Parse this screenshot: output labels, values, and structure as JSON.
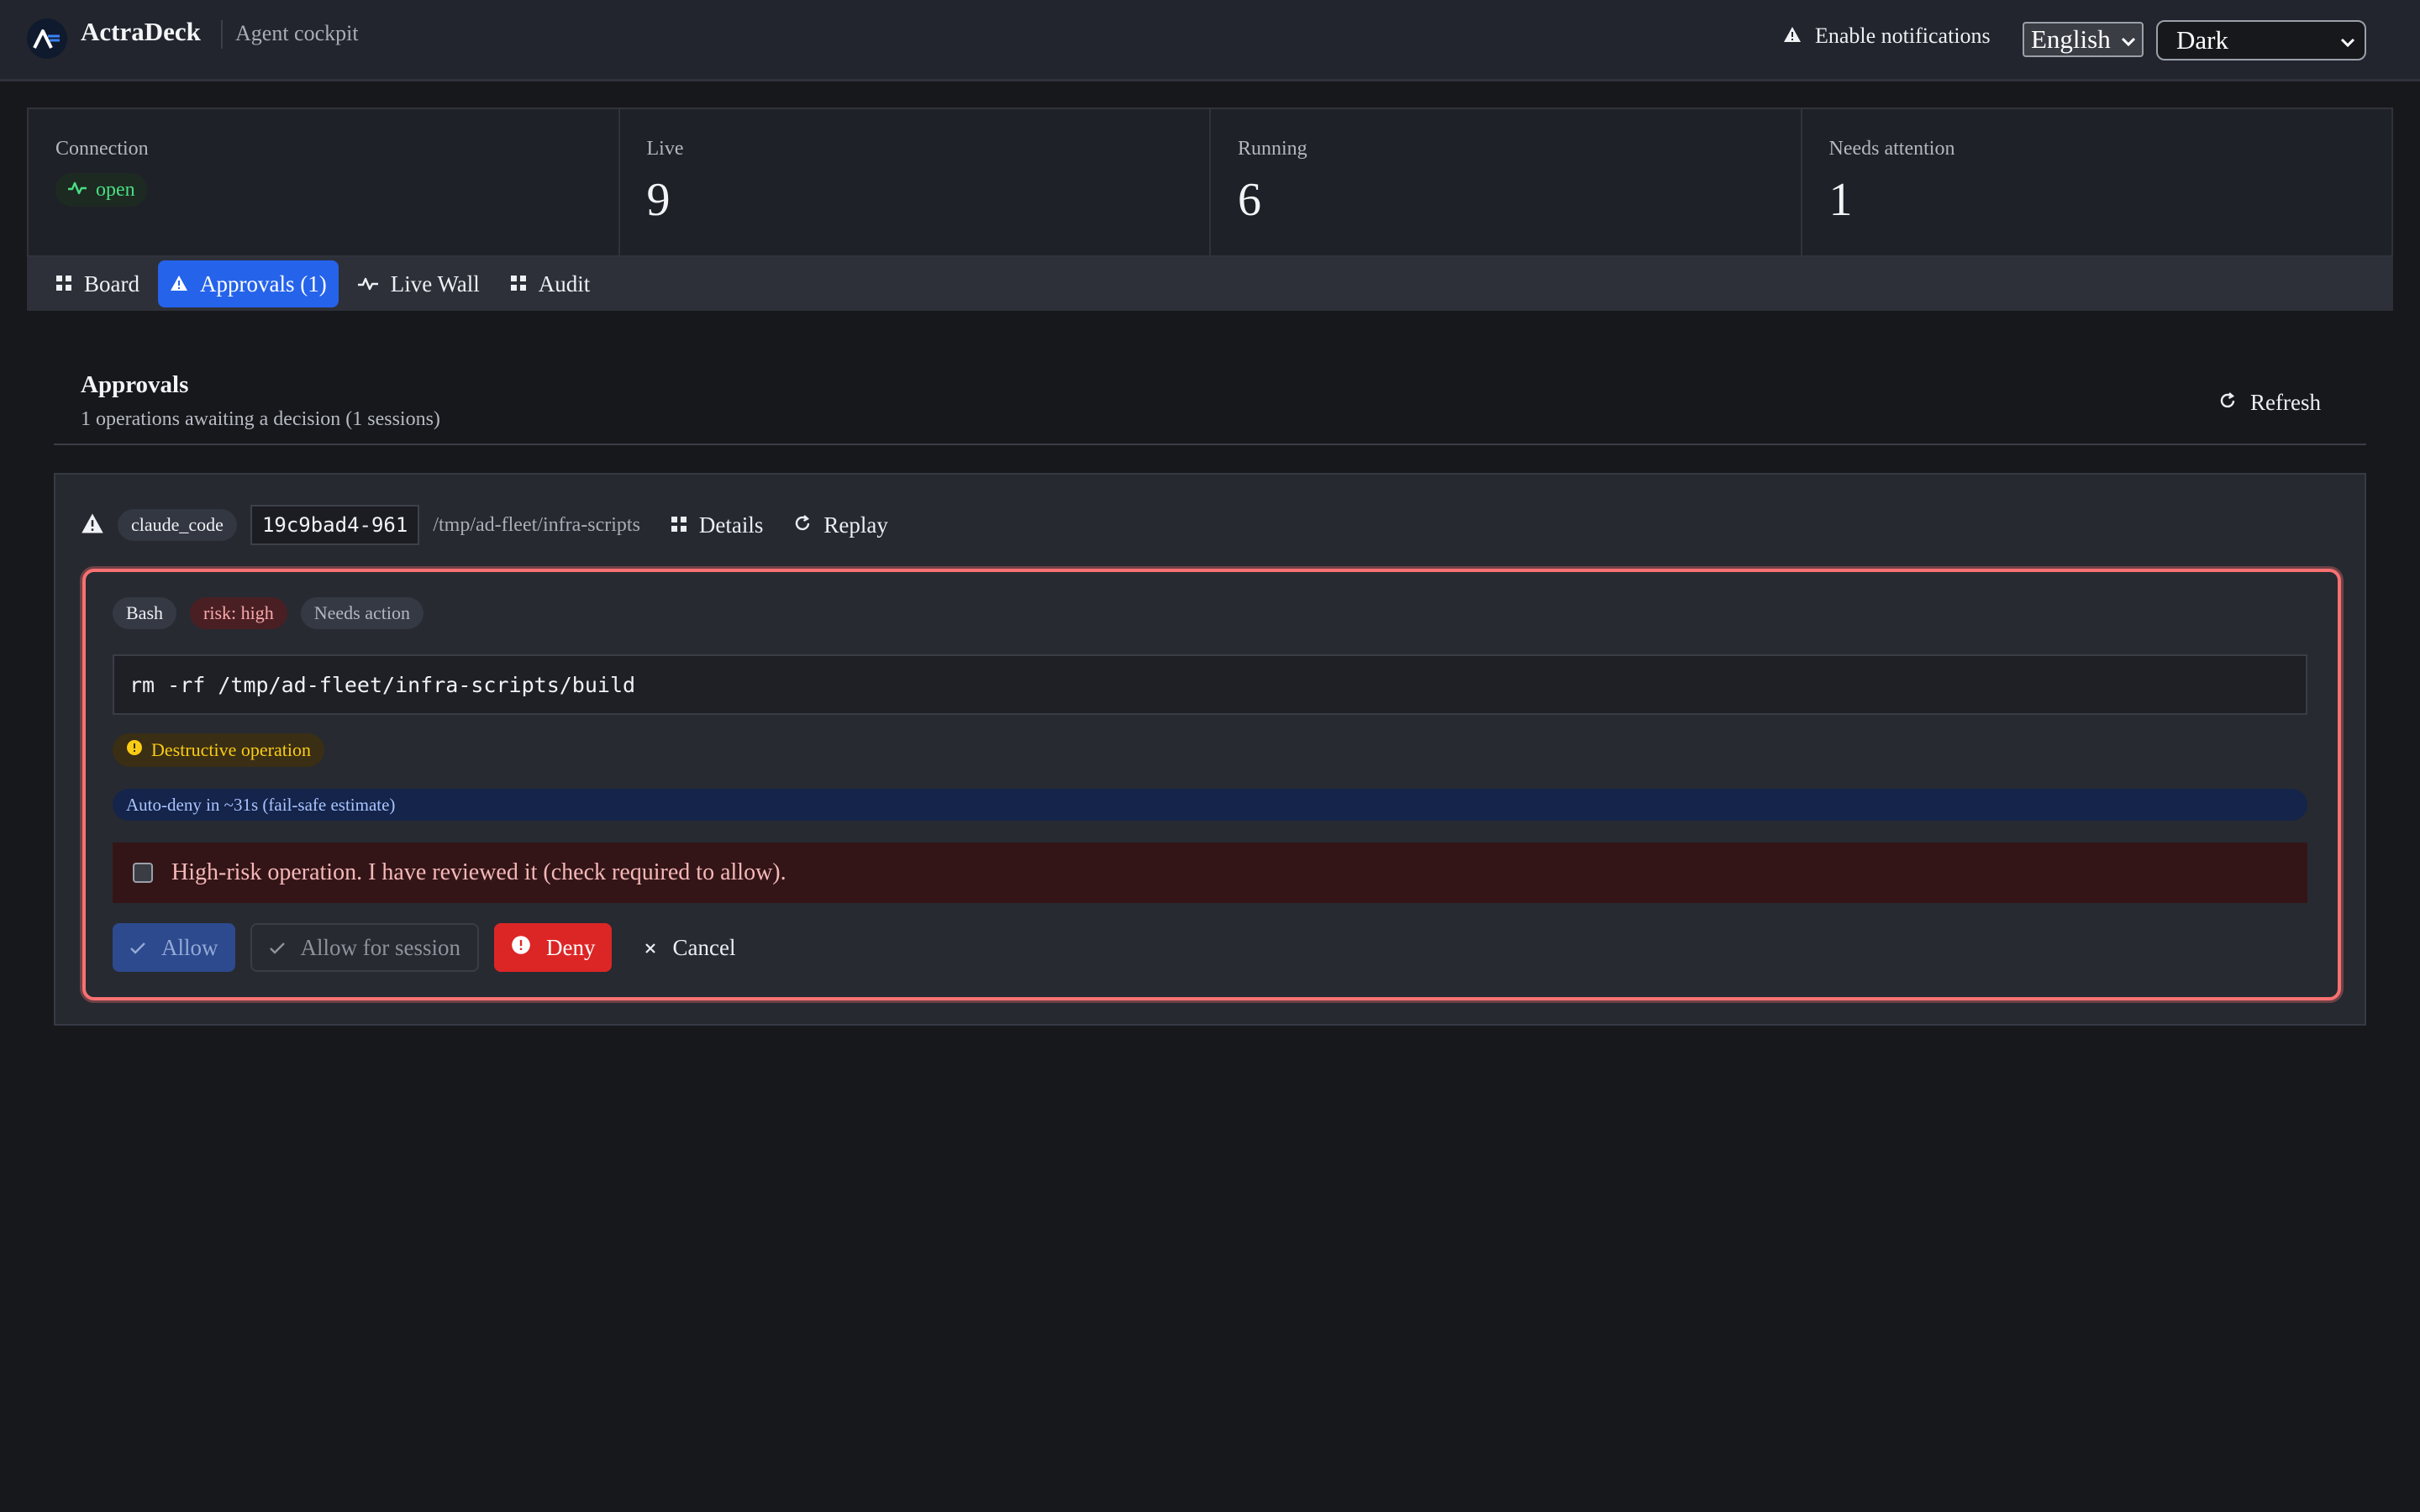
{
  "header": {
    "brand": "ActraDeck",
    "subtitle": "Agent cockpit",
    "notifications_label": "Enable notifications",
    "language_selected": "English",
    "theme_selected": "Dark"
  },
  "stats": {
    "connection": {
      "label": "Connection",
      "status": "open"
    },
    "live": {
      "label": "Live",
      "value": "9"
    },
    "running": {
      "label": "Running",
      "value": "6"
    },
    "attention": {
      "label": "Needs attention",
      "value": "1"
    }
  },
  "tabs": [
    {
      "label": "Board",
      "icon": "grid-icon"
    },
    {
      "label": "Approvals (1)",
      "icon": "warning-icon",
      "active": true
    },
    {
      "label": "Live Wall",
      "icon": "activity-icon"
    },
    {
      "label": "Audit",
      "icon": "grid-icon"
    }
  ],
  "approvals": {
    "title": "Approvals",
    "summary": "1 operations awaiting a decision (1 sessions)",
    "refresh_label": "Refresh"
  },
  "session": {
    "agent": "claude_code",
    "id": "19c9bad4-961",
    "path": "/tmp/ad-fleet/infra-scripts",
    "details_label": "Details",
    "replay_label": "Replay"
  },
  "request": {
    "tool": "Bash",
    "risk": "risk: high",
    "state": "Needs action",
    "command": "rm -rf /tmp/ad-fleet/infra-scripts/build",
    "flag": "Destructive operation",
    "auto_deny": "Auto-deny in ~31s (fail-safe estimate)",
    "confirm_text": "High-risk operation. I have reviewed it (check required to allow).",
    "allow_label": "Allow",
    "allow_session_label": "Allow for session",
    "deny_label": "Deny",
    "cancel_label": "Cancel"
  },
  "colors": {
    "accent": "#2563eb",
    "danger": "#dc2626",
    "success": "#4ade80",
    "warning": "#facc15"
  }
}
